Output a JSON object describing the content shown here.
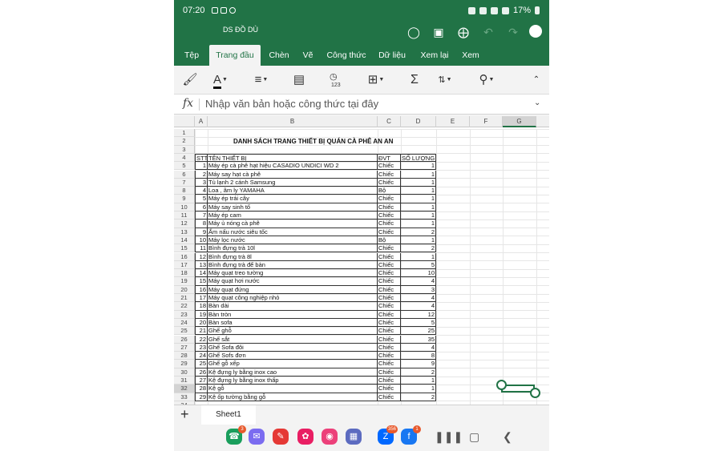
{
  "status": {
    "time": "07:20",
    "battery": "17%"
  },
  "titlebar": {
    "doc_title": "DS ĐỒ DÙ"
  },
  "tabs": [
    {
      "label": "Tệp",
      "active": false
    },
    {
      "label": "Trang đầu",
      "active": true
    },
    {
      "label": "Chèn",
      "active": false
    },
    {
      "label": "Vẽ",
      "active": false
    },
    {
      "label": "Công thức",
      "active": false
    },
    {
      "label": "Dữ liệu",
      "active": false
    },
    {
      "label": "Xem lại",
      "active": false
    },
    {
      "label": "Xem",
      "active": false
    }
  ],
  "toolbar": {
    "number_format_value": "123"
  },
  "formula": {
    "fx": "fx",
    "placeholder": "Nhập văn bản hoặc công thức tại đây"
  },
  "columns": [
    "A",
    "B",
    "C",
    "D",
    "E",
    "F",
    "G"
  ],
  "selected_column": "G",
  "selected_row": 32,
  "sheet": {
    "title": "DANH SÁCH TRANG THIẾT BỊ QUÁN CÀ PHÊ AN AN",
    "headers": {
      "stt": "STT",
      "name": "TÊN THIẾT BỊ",
      "unit": "ĐVT",
      "qty": "SỐ LƯỢNG"
    },
    "items": [
      {
        "stt": "1",
        "name": "Máy ép cà phê hạt hiệu CASADIO UNDICI WD 2",
        "unit": "Chiếc",
        "qty": "1"
      },
      {
        "stt": "2",
        "name": "Máy say hạt cà phê",
        "unit": "Chiếc",
        "qty": "1"
      },
      {
        "stt": "3",
        "name": "Tủ lạnh 2 cánh Samsung",
        "unit": "Chiếc",
        "qty": "1"
      },
      {
        "stt": "4",
        "name": "Loa , âm ly YAMAHA",
        "unit": "Bộ",
        "qty": "1"
      },
      {
        "stt": "5",
        "name": "Máy ép trái cây",
        "unit": "Chiếc",
        "qty": "1"
      },
      {
        "stt": "6",
        "name": "Máy say sinh tố",
        "unit": "Chiếc",
        "qty": "1"
      },
      {
        "stt": "7",
        "name": "Máy ép cam",
        "unit": "Chiếc",
        "qty": "1"
      },
      {
        "stt": "8",
        "name": "Máy ủ nóng cà phê",
        "unit": "Chiếc",
        "qty": "1"
      },
      {
        "stt": "9",
        "name": "Ấm nấu nước siêu tốc",
        "unit": "Chiếc",
        "qty": "2"
      },
      {
        "stt": "10",
        "name": "Máy lọc nước",
        "unit": "Bộ",
        "qty": "1"
      },
      {
        "stt": "11",
        "name": "Bình đựng trà 10l",
        "unit": "Chiếc",
        "qty": "2"
      },
      {
        "stt": "12",
        "name": "Bình đựng trà 8l",
        "unit": "Chiếc",
        "qty": "1"
      },
      {
        "stt": "13",
        "name": "Bình đựng trà để bàn",
        "unit": "Chiếc",
        "qty": "5"
      },
      {
        "stt": "14",
        "name": "Máy quạt treo tường",
        "unit": "Chiếc",
        "qty": "10"
      },
      {
        "stt": "15",
        "name": "Máy quạt hơi nước",
        "unit": "Chiếc",
        "qty": "4"
      },
      {
        "stt": "16",
        "name": "Máy quạt đứng",
        "unit": "Chiếc",
        "qty": "3"
      },
      {
        "stt": "17",
        "name": "Máy quạt công nghiệp nhỏ",
        "unit": "Chiếc",
        "qty": "4"
      },
      {
        "stt": "18",
        "name": "Bàn dài",
        "unit": "Chiếc",
        "qty": "4"
      },
      {
        "stt": "19",
        "name": "Bàn tròn",
        "unit": "Chiếc",
        "qty": "12"
      },
      {
        "stt": "20",
        "name": "Bàn sofa",
        "unit": "Chiếc",
        "qty": "5"
      },
      {
        "stt": "21",
        "name": "Ghế ghỗ",
        "unit": "Chiếc",
        "qty": "25"
      },
      {
        "stt": "22",
        "name": "Ghế sắt",
        "unit": "Chiếc",
        "qty": "35"
      },
      {
        "stt": "23",
        "name": "Ghế Sofa đôi",
        "unit": "Chiếc",
        "qty": "4"
      },
      {
        "stt": "24",
        "name": "Ghế Sofs đơn",
        "unit": "Chiếc",
        "qty": "8"
      },
      {
        "stt": "25",
        "name": "Ghế gỗ xếp",
        "unit": "Chiếc",
        "qty": "9"
      },
      {
        "stt": "26",
        "name": "Kệ đựng ly bằng inox cao",
        "unit": "Chiếc",
        "qty": "2"
      },
      {
        "stt": "27",
        "name": "Kệ đựng ly bằng inox thấp",
        "unit": "Chiếc",
        "qty": "1"
      },
      {
        "stt": "28",
        "name": "Kệ gỗ",
        "unit": "Chiếc",
        "qty": "1"
      },
      {
        "stt": "29",
        "name": "Kệ ốp tường bằng gỗ",
        "unit": "Chiếc",
        "qty": "2"
      }
    ]
  },
  "sheet_tabs": {
    "add_label": "+",
    "active_sheet": "Sheet1"
  },
  "dock": [
    {
      "name": "phone",
      "color": "#1a9e5c",
      "badge": "3"
    },
    {
      "name": "messages",
      "color": "#7b6cf0",
      "badge": ""
    },
    {
      "name": "notes",
      "color": "#e53935",
      "badge": ""
    },
    {
      "name": "flower",
      "color": "#e91e63",
      "badge": ""
    },
    {
      "name": "camera",
      "color": "#ec407a",
      "badge": ""
    },
    {
      "name": "apps",
      "color": "#5c6bc0",
      "badge": ""
    },
    {
      "name": "zalo",
      "color": "#0068ff",
      "badge": "356"
    },
    {
      "name": "facebook",
      "color": "#1877f2",
      "badge": "1"
    }
  ],
  "colors": {
    "accent": "#217346"
  }
}
